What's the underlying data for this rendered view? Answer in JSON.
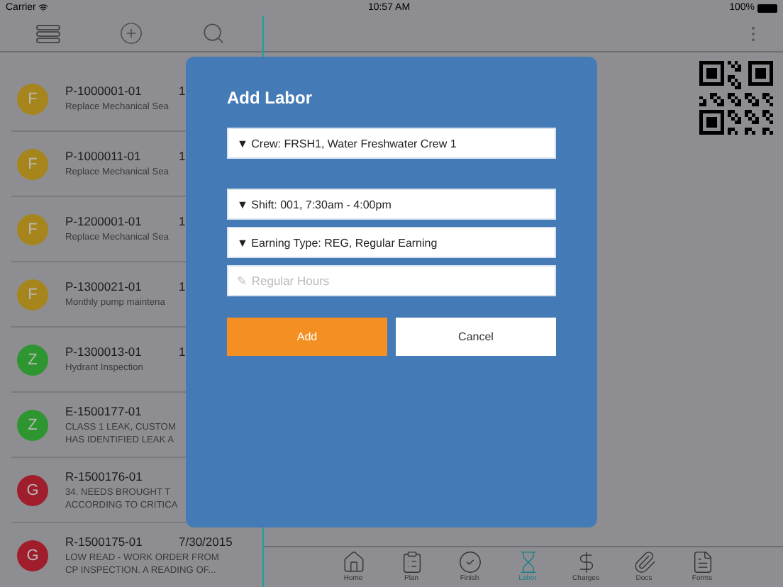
{
  "status_bar": {
    "carrier": "Carrier",
    "time": "10:57 AM",
    "battery": "100%"
  },
  "work_orders": [
    {
      "avatar": "F",
      "color": "#a6851c",
      "id": "P-1000001-01",
      "date": "1",
      "description": [
        "Replace Mechanical Sea"
      ]
    },
    {
      "avatar": "F",
      "color": "#a6851c",
      "id": "P-1000011-01",
      "date": "1",
      "description": [
        "Replace Mechanical Sea"
      ]
    },
    {
      "avatar": "F",
      "color": "#a6851c",
      "id": "P-1200001-01",
      "date": "1",
      "description": [
        "Replace Mechanical Sea"
      ]
    },
    {
      "avatar": "F",
      "color": "#a6851c",
      "id": "P-1300021-01",
      "date": "1",
      "description": [
        "Monthly pump maintena"
      ]
    },
    {
      "avatar": "Z",
      "color": "#2e9630",
      "id": "P-1300013-01",
      "date": "1",
      "description": [
        "Hydrant Inspection"
      ]
    },
    {
      "avatar": "Z",
      "color": "#2e9630",
      "id": "E-1500177-01",
      "description": [
        "CLASS 1 LEAK, CUSTOM",
        "HAS IDENTIFIED LEAK A"
      ]
    },
    {
      "avatar": "G",
      "color": "#a01e2c",
      "id": "R-1500176-01",
      "description": [
        "34. NEEDS BROUGHT T",
        "ACCORDING TO CRITICA"
      ]
    },
    {
      "avatar": "G",
      "color": "#a01e2c",
      "id": "R-1500175-01",
      "date": "7/30/2015",
      "description": [
        "LOW READ - WORK ORDER FROM",
        "CP INSPECTION. A READING OF..."
      ]
    }
  ],
  "bottom_tabs": [
    {
      "kind": "home",
      "label": "Home",
      "selected": false
    },
    {
      "kind": "plan",
      "label": "Plan",
      "selected": false
    },
    {
      "kind": "finish",
      "label": "Finish",
      "selected": false
    },
    {
      "kind": "labor",
      "label": "Labor",
      "selected": true
    },
    {
      "kind": "charges",
      "label": "Charges",
      "selected": false
    },
    {
      "kind": "docs",
      "label": "Docs",
      "selected": false
    },
    {
      "kind": "forms",
      "label": "Forms",
      "selected": false
    }
  ],
  "dialog": {
    "title": "Add Labor",
    "fields": [
      {
        "kind": "dropdown",
        "value": "▼ Crew: FRSH1, Water Freshwater Crew 1"
      },
      {
        "kind": "spacer"
      },
      {
        "kind": "dropdown",
        "value": "▼ Shift: 001, 7:30am - 4:00pm"
      },
      {
        "kind": "dropdown",
        "value": "▼ Earning Type: REG, Regular Earning"
      },
      {
        "kind": "input",
        "placeholder": "✎ Regular Hours"
      }
    ],
    "buttons": [
      {
        "kind": "primary",
        "label": "Add"
      },
      {
        "kind": "secondary",
        "label": "Cancel"
      }
    ]
  }
}
